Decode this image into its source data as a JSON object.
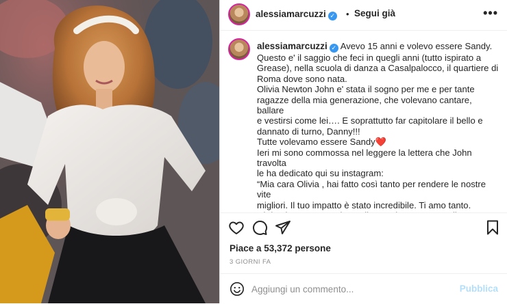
{
  "post": {
    "username": "alessiamarcuzzi",
    "separator": "•",
    "follow_label": "Segui già",
    "more_label": "•••",
    "caption_text": "Avevo 15 anni e volevo essere Sandy.\nQuesto e' il saggio che feci in quegli anni (tutto ispirato a\nGrease), nella scuola di danza a Casalpalocco, il quartiere di\nRoma dove sono nata.\nOlivia Newton John e' stata il sogno per me e per tante\nragazze della mia generazione, che volevano cantare, ballare\ne vestirsi come lei…. E soprattutto far capitolare il bello e\ndannato di turno, Danny!!!\nTutte volevamo essere Sandy",
    "caption_emoji": "❤️",
    "caption_rest": "\nIeri mi sono commossa nel leggere la lettera che John travolta\nle ha dedicato qui su instagram:\n“Mia cara Olivia , hai fatto così tanto per rendere le nostre vite\nmigliori. Il tuo impatto è stato incredibile. Ti amo tanto.\nCi rivedremo ancora lungo il cammino e saremo di nuovo uniti,\ndi nuovo insieme. Sono sempre stato tuo dal primo momento\nin cui ti ho vista e lo sarò sempre. Il tuo Danny, il tuo John”.",
    "likes_text": "Piace a 53,372 persone",
    "time_ago": "3 GIORNI FA",
    "comment_placeholder": "Aggiungi un commento...",
    "publish_label": "Pubblica"
  },
  "icons": {
    "like": "heart-outline-icon",
    "comment": "speech-bubble-icon",
    "share": "paper-plane-icon",
    "save": "bookmark-icon",
    "emoji": "smiley-icon",
    "verified": "verified-badge-icon"
  },
  "colors": {
    "verified": "#3897f0",
    "publish_disabled": "#b2dffc",
    "secondary_text": "#8e8e8e",
    "heart": "#e0245e"
  }
}
